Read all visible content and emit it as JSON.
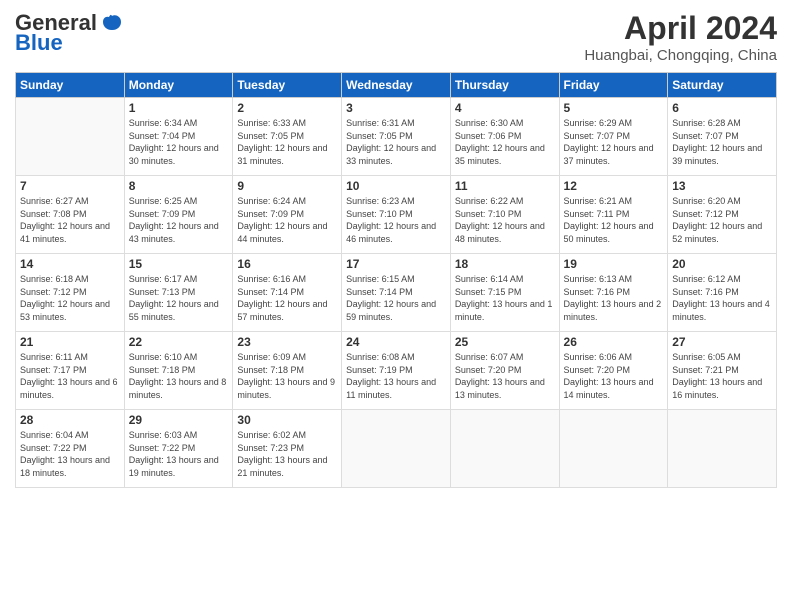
{
  "header": {
    "logo_general": "General",
    "logo_blue": "Blue",
    "month": "April 2024",
    "location": "Huangbai, Chongqing, China"
  },
  "weekdays": [
    "Sunday",
    "Monday",
    "Tuesday",
    "Wednesday",
    "Thursday",
    "Friday",
    "Saturday"
  ],
  "weeks": [
    [
      {
        "day": "",
        "empty": true
      },
      {
        "day": "1",
        "sunrise": "Sunrise: 6:34 AM",
        "sunset": "Sunset: 7:04 PM",
        "daylight": "Daylight: 12 hours and 30 minutes."
      },
      {
        "day": "2",
        "sunrise": "Sunrise: 6:33 AM",
        "sunset": "Sunset: 7:05 PM",
        "daylight": "Daylight: 12 hours and 31 minutes."
      },
      {
        "day": "3",
        "sunrise": "Sunrise: 6:31 AM",
        "sunset": "Sunset: 7:05 PM",
        "daylight": "Daylight: 12 hours and 33 minutes."
      },
      {
        "day": "4",
        "sunrise": "Sunrise: 6:30 AM",
        "sunset": "Sunset: 7:06 PM",
        "daylight": "Daylight: 12 hours and 35 minutes."
      },
      {
        "day": "5",
        "sunrise": "Sunrise: 6:29 AM",
        "sunset": "Sunset: 7:07 PM",
        "daylight": "Daylight: 12 hours and 37 minutes."
      },
      {
        "day": "6",
        "sunrise": "Sunrise: 6:28 AM",
        "sunset": "Sunset: 7:07 PM",
        "daylight": "Daylight: 12 hours and 39 minutes."
      }
    ],
    [
      {
        "day": "7",
        "sunrise": "Sunrise: 6:27 AM",
        "sunset": "Sunset: 7:08 PM",
        "daylight": "Daylight: 12 hours and 41 minutes."
      },
      {
        "day": "8",
        "sunrise": "Sunrise: 6:25 AM",
        "sunset": "Sunset: 7:09 PM",
        "daylight": "Daylight: 12 hours and 43 minutes."
      },
      {
        "day": "9",
        "sunrise": "Sunrise: 6:24 AM",
        "sunset": "Sunset: 7:09 PM",
        "daylight": "Daylight: 12 hours and 44 minutes."
      },
      {
        "day": "10",
        "sunrise": "Sunrise: 6:23 AM",
        "sunset": "Sunset: 7:10 PM",
        "daylight": "Daylight: 12 hours and 46 minutes."
      },
      {
        "day": "11",
        "sunrise": "Sunrise: 6:22 AM",
        "sunset": "Sunset: 7:10 PM",
        "daylight": "Daylight: 12 hours and 48 minutes."
      },
      {
        "day": "12",
        "sunrise": "Sunrise: 6:21 AM",
        "sunset": "Sunset: 7:11 PM",
        "daylight": "Daylight: 12 hours and 50 minutes."
      },
      {
        "day": "13",
        "sunrise": "Sunrise: 6:20 AM",
        "sunset": "Sunset: 7:12 PM",
        "daylight": "Daylight: 12 hours and 52 minutes."
      }
    ],
    [
      {
        "day": "14",
        "sunrise": "Sunrise: 6:18 AM",
        "sunset": "Sunset: 7:12 PM",
        "daylight": "Daylight: 12 hours and 53 minutes."
      },
      {
        "day": "15",
        "sunrise": "Sunrise: 6:17 AM",
        "sunset": "Sunset: 7:13 PM",
        "daylight": "Daylight: 12 hours and 55 minutes."
      },
      {
        "day": "16",
        "sunrise": "Sunrise: 6:16 AM",
        "sunset": "Sunset: 7:14 PM",
        "daylight": "Daylight: 12 hours and 57 minutes."
      },
      {
        "day": "17",
        "sunrise": "Sunrise: 6:15 AM",
        "sunset": "Sunset: 7:14 PM",
        "daylight": "Daylight: 12 hours and 59 minutes."
      },
      {
        "day": "18",
        "sunrise": "Sunrise: 6:14 AM",
        "sunset": "Sunset: 7:15 PM",
        "daylight": "Daylight: 13 hours and 1 minute."
      },
      {
        "day": "19",
        "sunrise": "Sunrise: 6:13 AM",
        "sunset": "Sunset: 7:16 PM",
        "daylight": "Daylight: 13 hours and 2 minutes."
      },
      {
        "day": "20",
        "sunrise": "Sunrise: 6:12 AM",
        "sunset": "Sunset: 7:16 PM",
        "daylight": "Daylight: 13 hours and 4 minutes."
      }
    ],
    [
      {
        "day": "21",
        "sunrise": "Sunrise: 6:11 AM",
        "sunset": "Sunset: 7:17 PM",
        "daylight": "Daylight: 13 hours and 6 minutes."
      },
      {
        "day": "22",
        "sunrise": "Sunrise: 6:10 AM",
        "sunset": "Sunset: 7:18 PM",
        "daylight": "Daylight: 13 hours and 8 minutes."
      },
      {
        "day": "23",
        "sunrise": "Sunrise: 6:09 AM",
        "sunset": "Sunset: 7:18 PM",
        "daylight": "Daylight: 13 hours and 9 minutes."
      },
      {
        "day": "24",
        "sunrise": "Sunrise: 6:08 AM",
        "sunset": "Sunset: 7:19 PM",
        "daylight": "Daylight: 13 hours and 11 minutes."
      },
      {
        "day": "25",
        "sunrise": "Sunrise: 6:07 AM",
        "sunset": "Sunset: 7:20 PM",
        "daylight": "Daylight: 13 hours and 13 minutes."
      },
      {
        "day": "26",
        "sunrise": "Sunrise: 6:06 AM",
        "sunset": "Sunset: 7:20 PM",
        "daylight": "Daylight: 13 hours and 14 minutes."
      },
      {
        "day": "27",
        "sunrise": "Sunrise: 6:05 AM",
        "sunset": "Sunset: 7:21 PM",
        "daylight": "Daylight: 13 hours and 16 minutes."
      }
    ],
    [
      {
        "day": "28",
        "sunrise": "Sunrise: 6:04 AM",
        "sunset": "Sunset: 7:22 PM",
        "daylight": "Daylight: 13 hours and 18 minutes."
      },
      {
        "day": "29",
        "sunrise": "Sunrise: 6:03 AM",
        "sunset": "Sunset: 7:22 PM",
        "daylight": "Daylight: 13 hours and 19 minutes."
      },
      {
        "day": "30",
        "sunrise": "Sunrise: 6:02 AM",
        "sunset": "Sunset: 7:23 PM",
        "daylight": "Daylight: 13 hours and 21 minutes."
      },
      {
        "day": "",
        "empty": true
      },
      {
        "day": "",
        "empty": true
      },
      {
        "day": "",
        "empty": true
      },
      {
        "day": "",
        "empty": true
      }
    ]
  ]
}
